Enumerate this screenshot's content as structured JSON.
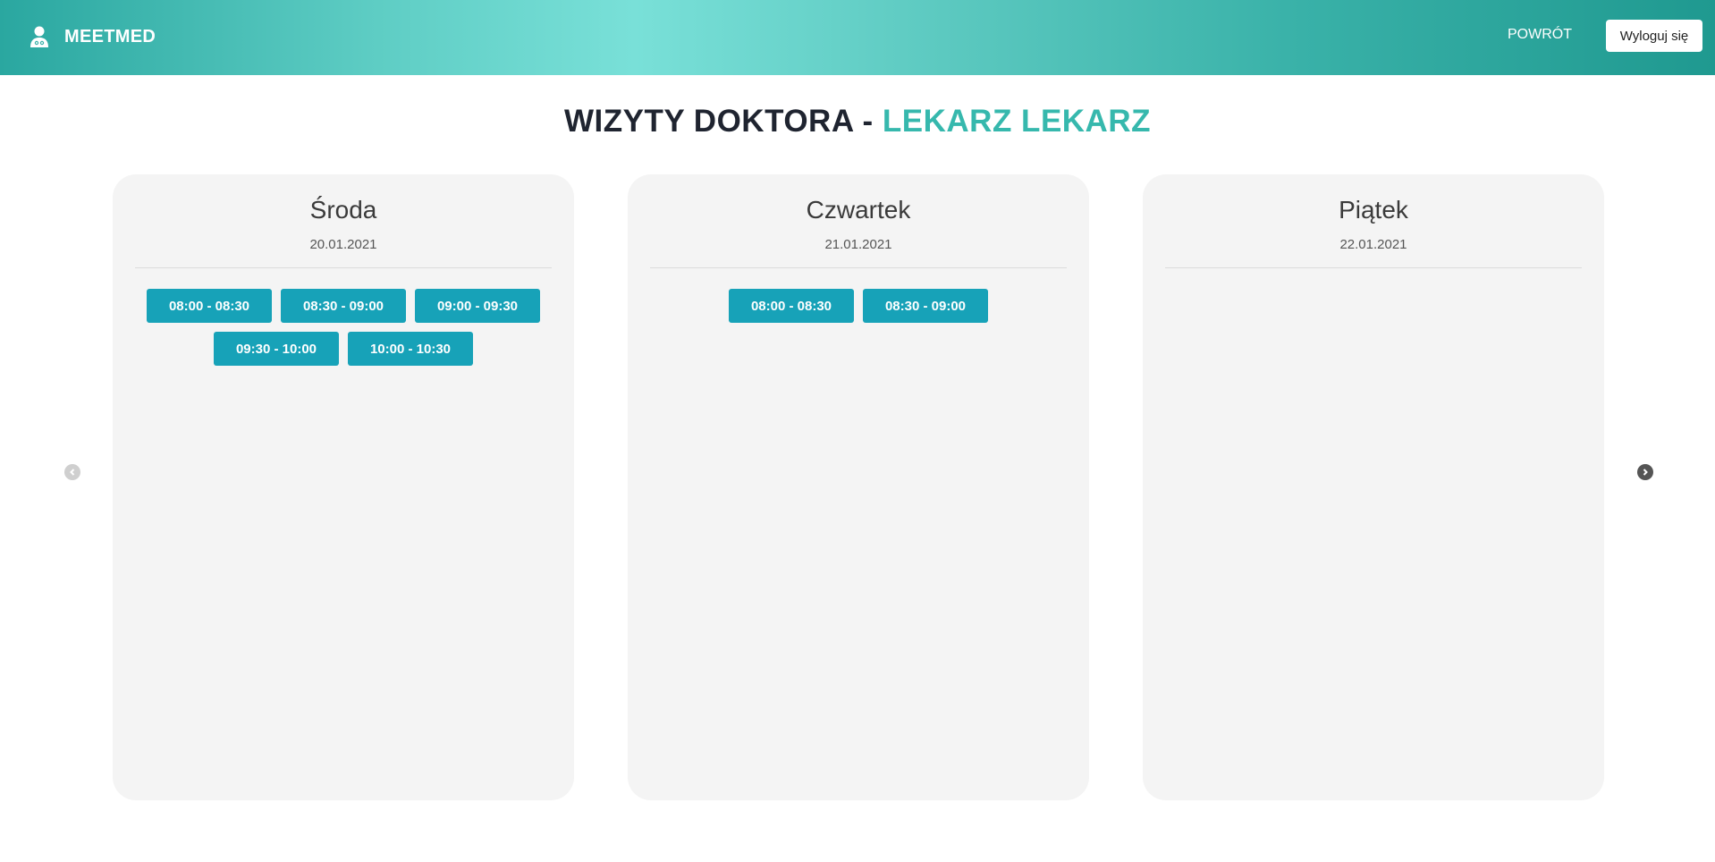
{
  "header": {
    "brand": "MEETMED",
    "back_label": "POWRÓT",
    "logout_label": "Wyloguj się"
  },
  "page": {
    "title_prefix": "WIZYTY DOKTORA - ",
    "doctor_name": "LEKARZ LEKARZ"
  },
  "days": [
    {
      "name": "Środa",
      "date": "20.01.2021",
      "slots": [
        "08:00 - 08:30",
        "08:30 - 09:00",
        "09:00 - 09:30",
        "09:30 - 10:00",
        "10:00 - 10:30"
      ]
    },
    {
      "name": "Czwartek",
      "date": "21.01.2021",
      "slots": [
        "08:00 - 08:30",
        "08:30 - 09:00"
      ]
    },
    {
      "name": "Piątek",
      "date": "22.01.2021",
      "slots": []
    }
  ],
  "carousel": {
    "prev_icon": "chevron-left-icon",
    "next_icon": "chevron-right-icon"
  },
  "colors": {
    "accent": "#36b8ad",
    "slot_button": "#17a2b8",
    "card_bg": "#f4f4f4"
  }
}
